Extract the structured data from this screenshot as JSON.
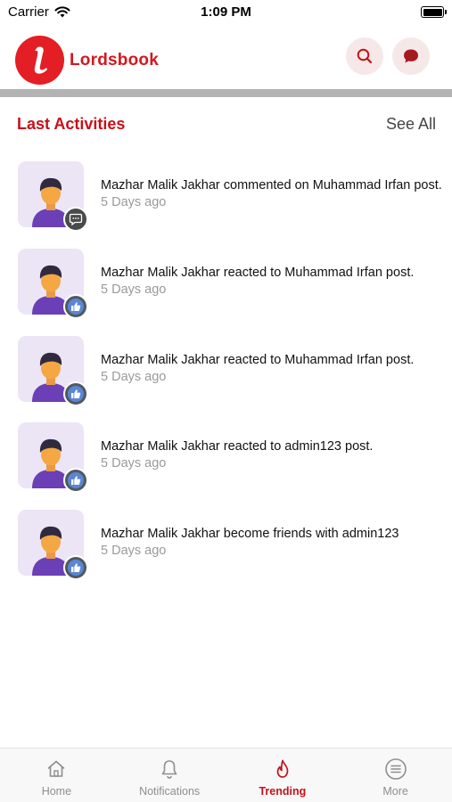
{
  "status_bar": {
    "carrier": "Carrier",
    "time": "1:09 PM"
  },
  "header": {
    "app_name": "Lordsbook",
    "logo_letter": "l"
  },
  "section": {
    "title": "Last Activities",
    "see_all": "See All"
  },
  "activities": [
    {
      "text": "Mazhar Malik Jakhar commented on Muhammad Irfan post.",
      "time": "5 Days ago",
      "badge_icon": "comment-icon"
    },
    {
      "text": "Mazhar Malik Jakhar reacted to Muhammad Irfan post.",
      "time": "5 Days ago",
      "badge_icon": "thumbs-up-icon"
    },
    {
      "text": "Mazhar Malik Jakhar reacted to Muhammad Irfan post.",
      "time": "5 Days ago",
      "badge_icon": "thumbs-up-icon"
    },
    {
      "text": "Mazhar Malik Jakhar reacted to admin123 post.",
      "time": "5 Days ago",
      "badge_icon": "thumbs-up-icon"
    },
    {
      "text": "Mazhar Malik Jakhar become friends with admin123",
      "time": "5 Days ago",
      "badge_icon": "thumbs-up-icon"
    }
  ],
  "tabs": [
    {
      "label": "Home",
      "icon": "home-icon"
    },
    {
      "label": "Notifications",
      "icon": "bell-icon"
    },
    {
      "label": "Trending",
      "icon": "flame-icon",
      "active": true
    },
    {
      "label": "More",
      "icon": "menu-icon"
    }
  ],
  "colors": {
    "brand_red": "#e31e24",
    "accent_text": "#c4121a",
    "muted_text": "#9a9a9a",
    "avatar_bg": "#ece5f6"
  }
}
